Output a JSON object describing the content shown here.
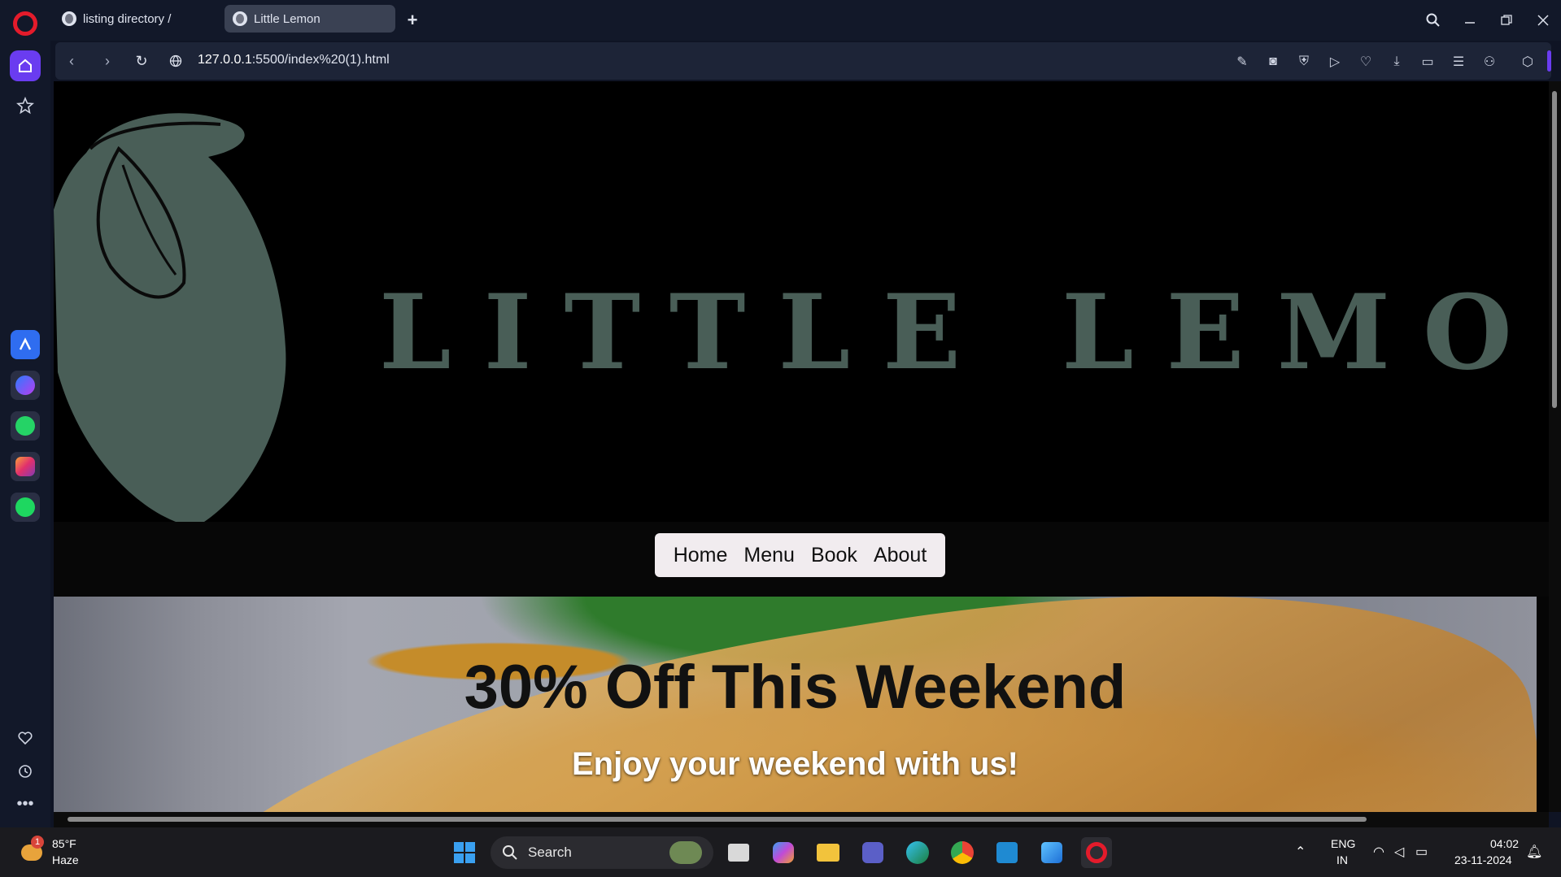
{
  "browser": {
    "tabs": [
      {
        "label": "listing directory /",
        "active": false
      },
      {
        "label": "Little Lemon",
        "active": true
      }
    ],
    "url_host": "127.0.0.1",
    "url_rest": ":5500/index%20(1).html"
  },
  "page": {
    "brand": "LITTLE LEMON",
    "nav": [
      "Home",
      "Menu",
      "Book",
      "About"
    ],
    "hero_title": "30% Off This Weekend",
    "hero_subtitle": "Enjoy your weekend with us!",
    "brand_color": "#495e57"
  },
  "taskbar": {
    "weather_temp": "85°F",
    "weather_desc": "Haze",
    "weather_badge": "1",
    "search_label": "Search",
    "lang_top": "ENG",
    "lang_bottom": "IN",
    "time": "04:02",
    "date": "23-11-2024"
  },
  "icons": {
    "accent": "#6a3cf0",
    "opera_red": "#e41b2b"
  }
}
